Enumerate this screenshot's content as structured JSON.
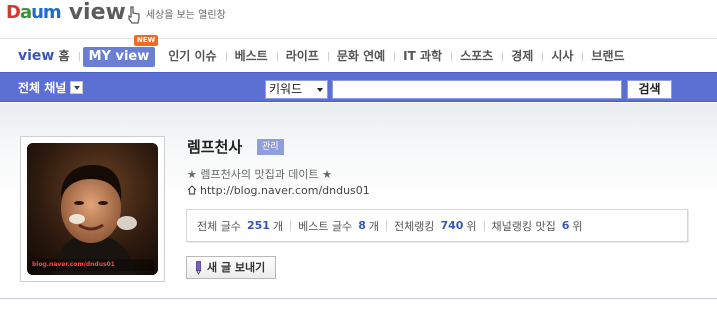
{
  "logo": {
    "brand_d": "D",
    "brand_a": "a",
    "brand_um": "um",
    "product": "view",
    "slogan": "세상을 보는 열린창",
    "mascot_icon": "pointing-hand-icon"
  },
  "nav": {
    "home_v": "view",
    "home_label": "홈",
    "active_label": "MY view",
    "new_badge": "NEW",
    "items": [
      {
        "label": "인기 이슈"
      },
      {
        "label": "베스트"
      },
      {
        "label": "라이프"
      },
      {
        "label": "문화 연예"
      },
      {
        "label": "IT 과학"
      },
      {
        "label": "스포츠"
      },
      {
        "label": "경제"
      },
      {
        "label": "시사"
      },
      {
        "label": "브랜드"
      }
    ]
  },
  "search": {
    "channel_label": "전체 채널",
    "select_value": "키워드",
    "input_value": "",
    "button_label": "검색"
  },
  "profile": {
    "blog_name": "렘프천사",
    "admin_badge": "관리",
    "description": "★ 렘프천사의 맛집과 데이트 ★",
    "url": "http://blog.naver.com/dndus01",
    "photo_caption": "blog.naver.com/dndus01",
    "stats": {
      "total_label": "전체 글수",
      "total_value": "251",
      "total_unit": "개",
      "best_label": "베스트 글수",
      "best_value": "8",
      "best_unit": "개",
      "rank_label": "전체랭킹",
      "rank_value": "740",
      "rank_unit": "위",
      "channel_rank_label": "채널랭킹 맛집",
      "channel_rank_value": "6",
      "channel_rank_unit": "위"
    },
    "send_button": "새 글 보내기"
  },
  "colors": {
    "strip": "#5c6fd3",
    "accent_blue": "#3a57b5",
    "new_badge": "#f26a21",
    "admin_badge": "#8f9fdc"
  }
}
